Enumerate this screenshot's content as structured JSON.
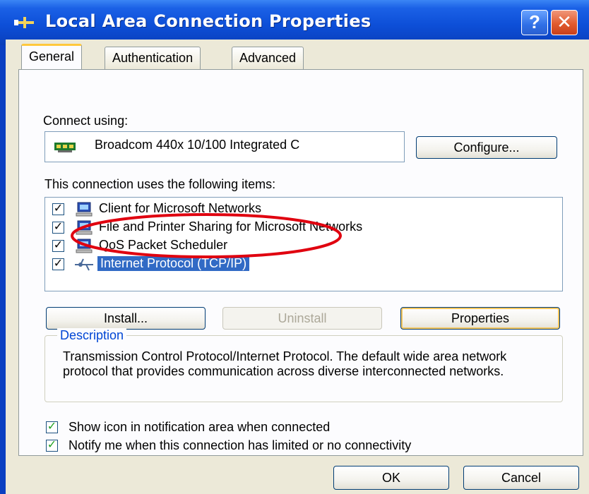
{
  "window": {
    "title": "Local Area Connection Properties",
    "help_label": "?",
    "close_label": "✕"
  },
  "tabs": [
    {
      "label": "General",
      "active": true
    },
    {
      "label": "Authentication",
      "active": false
    },
    {
      "label": "Advanced",
      "active": false
    }
  ],
  "general": {
    "connect_using_label": "Connect using:",
    "adapter_name": "Broadcom 440x 10/100 Integrated C",
    "configure_label": "Configure...",
    "items_label": "This connection uses the following items:",
    "items": [
      {
        "label": "Client for Microsoft Networks",
        "checked": true
      },
      {
        "label": "File and Printer Sharing for Microsoft Networks",
        "checked": true
      },
      {
        "label": "QoS Packet Scheduler",
        "checked": true
      },
      {
        "label": "Internet Protocol (TCP/IP)",
        "checked": true,
        "selected": true
      }
    ],
    "install_label": "Install...",
    "uninstall_label": "Uninstall",
    "properties_label": "Properties",
    "description_legend": "Description",
    "description_text": "Transmission Control Protocol/Internet Protocol. The default wide area network protocol that provides communication across diverse interconnected networks.",
    "show_icon_label": "Show icon in notification area when connected",
    "notify_label": "Notify me when this connection has limited or no connectivity"
  },
  "footer": {
    "ok_label": "OK",
    "cancel_label": "Cancel"
  },
  "colors": {
    "title_bar": "#0b46c9",
    "dialog_bg": "#ece9d8",
    "selection": "#316ac5",
    "annotation": "#e0000f"
  }
}
